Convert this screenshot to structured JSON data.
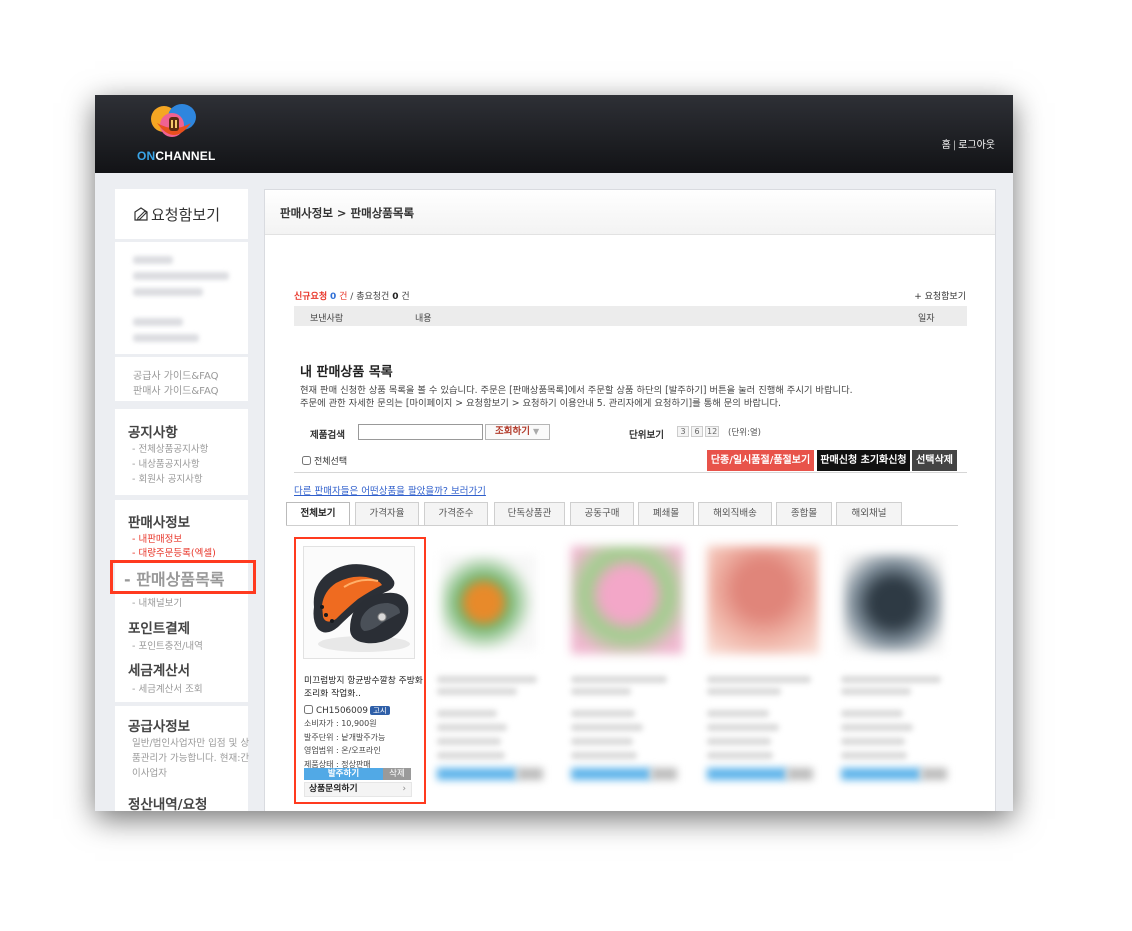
{
  "header": {
    "logo_on": "ON",
    "logo_channel": "CHANNEL",
    "home_link": "홈",
    "logout_link": "로그아웃",
    "separator": "|"
  },
  "sidebar": {
    "inbox_label": "요청함보기",
    "guides": [
      "공급사 가이드&FAQ",
      "판매사 가이드&FAQ"
    ],
    "notice": {
      "title": "공지사항",
      "items": [
        "- 전체상품공지사항",
        "- 내상품공지사항",
        "- 회원사 공지사항"
      ]
    },
    "seller": {
      "title": "판매사정보",
      "items": [
        "- 내판매정보",
        "- 대량주문등록(엑셀)",
        "- 판매상품목록",
        "- 내채널보기"
      ]
    },
    "point": {
      "title": "포인트결제",
      "items": [
        "- 포인트충전/내역"
      ]
    },
    "tax": {
      "title": "세금계산서",
      "items": [
        "- 세금계산서 조회"
      ]
    },
    "supplier": {
      "title": "공급사정보",
      "desc": "일반/법인사업자만 입점 및 상품관리가 가능합니다. 현재:간이사업자"
    },
    "settlement": {
      "title": "정산내역/요청"
    }
  },
  "main": {
    "breadcrumb": "판매사정보 > 판매상품목록",
    "requests": {
      "new_label": "신규요청",
      "new_count": "0",
      "new_unit": "건",
      "slash": "/",
      "total_label": "총요청건",
      "total_count": "0",
      "total_unit": "건",
      "more": "+ 요청함보기",
      "columns": [
        "보낸사람",
        "내용",
        "일자"
      ]
    },
    "list_title": "내 판매상품 목록",
    "desc_line1": "현재 판매 신청한 상품 목록을 볼 수 있습니다. 주문은 [판매상품목록]에서 주문할 상품 하단의 [발주하기] 버튼을 눌러 진행해 주시기 바랍니다.",
    "desc_line2": "주문에 관한 자세한 문의는 [마이페이지 > 요청함보기 > 요청하기 이용안내 5. 관리자에게 요청하기]를 통해 문의 바랍니다.",
    "search": {
      "label": "제품검색",
      "value": "",
      "button": "조회하기",
      "caret": "▼"
    },
    "unit": {
      "label": "단위보기",
      "options": [
        "3",
        "6",
        "12"
      ],
      "note": "(단위:열)"
    },
    "select_all": "전체선택",
    "actions": [
      "단종/일시품절/품절보기",
      "판매신청 초기화신청",
      "선택삭제"
    ],
    "other_link": "다른 판매자들은 어떤상품을 팔았을까? 보러가기",
    "tabs": [
      "전체보기",
      "가격자율",
      "가격준수",
      "단독상품관",
      "공동구매",
      "폐쇄몰",
      "해외직배송",
      "종합몰",
      "해외채널"
    ],
    "product": {
      "name": "미끄럼방지 항균방수깔창 주방화 조리화 작업화..",
      "code": "CH1506009",
      "badge": "고시",
      "info": [
        "소비자가 : 10,900원",
        "발주단위 : 낱개발주가능",
        "영업범위 : 온/오프라인",
        "제품상태 : 정상판매"
      ],
      "order_button": "발주하기",
      "delete_button": "삭제",
      "inquiry_button": "상품문의하기",
      "inquiry_arrow": "›"
    }
  },
  "colors": {
    "header_bg": "#1c1d21",
    "highlight": "#ff3a1f",
    "red_button": "#e8534a",
    "order_blue": "#51a9e6",
    "link_blue": "#2f5fcc",
    "badge_blue": "#2f5fa8"
  },
  "icons": [
    "logo-heart-icon",
    "inbox-pencil-icon",
    "shoe-product-image"
  ]
}
